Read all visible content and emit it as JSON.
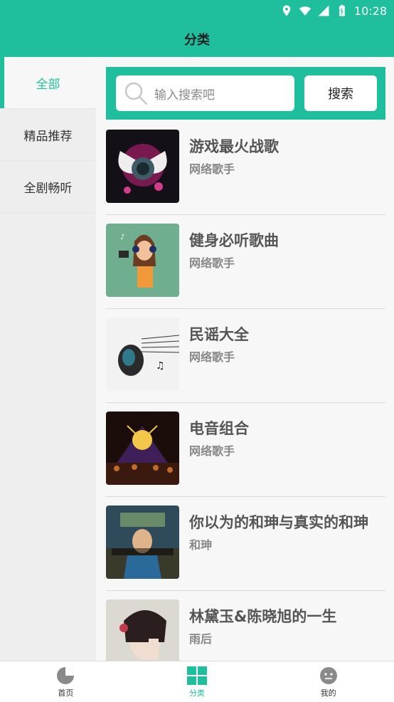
{
  "status_bar": {
    "time": "10:28"
  },
  "header": {
    "title": "分类"
  },
  "sidebar": {
    "items": [
      {
        "label": "全部",
        "active": true
      },
      {
        "label": "精品推荐",
        "active": false
      },
      {
        "label": "全剧畅听",
        "active": false
      }
    ]
  },
  "search": {
    "placeholder": "输入搜索吧",
    "button_label": "搜索"
  },
  "list": [
    {
      "name": "游戏最火战歌",
      "artist": "网络歌手"
    },
    {
      "name": "健身必听歌曲",
      "artist": "网络歌手"
    },
    {
      "name": "民谣大全",
      "artist": "网络歌手"
    },
    {
      "name": "电音组合",
      "artist": "网络歌手"
    },
    {
      "name": "你以为的和珅与真实的和珅",
      "artist": "和珅"
    },
    {
      "name": "林黛玉&陈晓旭的一生",
      "artist": "雨后"
    }
  ],
  "bottom_nav": [
    {
      "label": "首页",
      "icon": "home-icon",
      "active": false
    },
    {
      "label": "分类",
      "icon": "category-icon",
      "active": true
    },
    {
      "label": "我的",
      "icon": "profile-icon",
      "active": false
    }
  ],
  "colors": {
    "accent": "#1fbf9d"
  }
}
